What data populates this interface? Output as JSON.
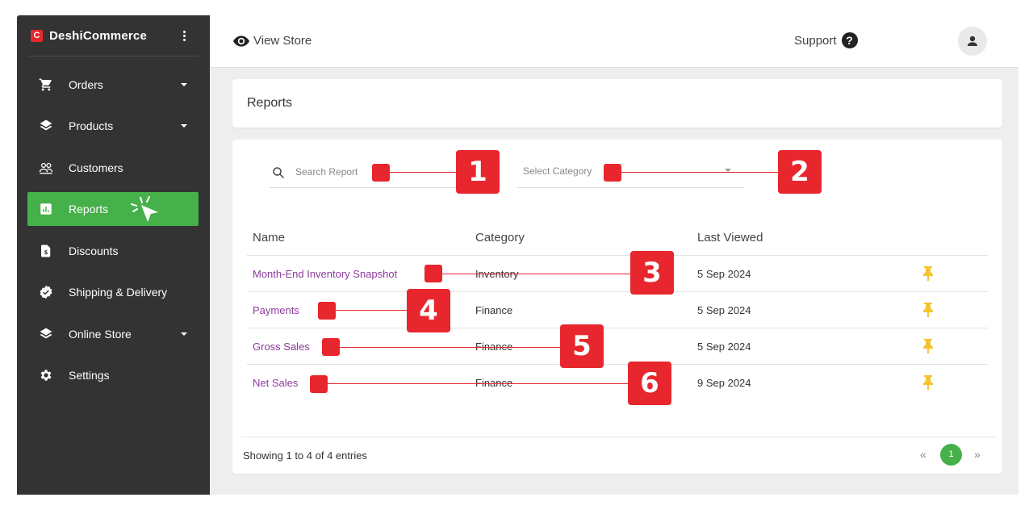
{
  "brand": {
    "logo_letter": "C",
    "name": "DeshiCommerce"
  },
  "sidebar": {
    "items": [
      {
        "label": "Orders",
        "icon": "cart-icon",
        "has_caret": true
      },
      {
        "label": "Products",
        "icon": "layers-icon",
        "has_caret": true
      },
      {
        "label": "Customers",
        "icon": "users-icon",
        "has_caret": false
      },
      {
        "label": "Reports",
        "icon": "bar-chart-icon",
        "has_caret": false,
        "active": true
      },
      {
        "label": "Discounts",
        "icon": "document-icon",
        "has_caret": false
      },
      {
        "label": "Shipping & Delivery",
        "icon": "badge-check-icon",
        "has_caret": false
      },
      {
        "label": "Online Store",
        "icon": "layers-icon",
        "has_caret": true
      },
      {
        "label": "Settings",
        "icon": "gear-icon",
        "has_caret": false
      }
    ]
  },
  "topbar": {
    "view_store": "View Store",
    "support": "Support",
    "help_glyph": "?"
  },
  "page": {
    "title": "Reports"
  },
  "filters": {
    "search_placeholder": "Search Report",
    "category_placeholder": "Select Category"
  },
  "table": {
    "headers": [
      "Name",
      "Category",
      "Last Viewed"
    ],
    "rows": [
      {
        "name": "Month-End Inventory Snapshot",
        "category": "Inventory",
        "last_viewed": "5 Sep 2024"
      },
      {
        "name": "Payments",
        "category": "Finance",
        "last_viewed": "5 Sep 2024"
      },
      {
        "name": "Gross Sales",
        "category": "Finance",
        "last_viewed": "5 Sep 2024"
      },
      {
        "name": "Net Sales",
        "category": "Finance",
        "last_viewed": "9 Sep 2024"
      }
    ]
  },
  "footer": {
    "showing": "Showing 1 to 4 of 4 entries",
    "prev": "«",
    "page": "1",
    "next": "»"
  },
  "annotations": {
    "labels": [
      "1",
      "2",
      "3",
      "4",
      "5",
      "6"
    ]
  },
  "colors": {
    "sidebar_bg": "#333333",
    "active_green": "#46b04a",
    "link_purple": "#8e3b9e",
    "annotation_red": "#e8262d",
    "pin_yellow": "#f4c430"
  }
}
